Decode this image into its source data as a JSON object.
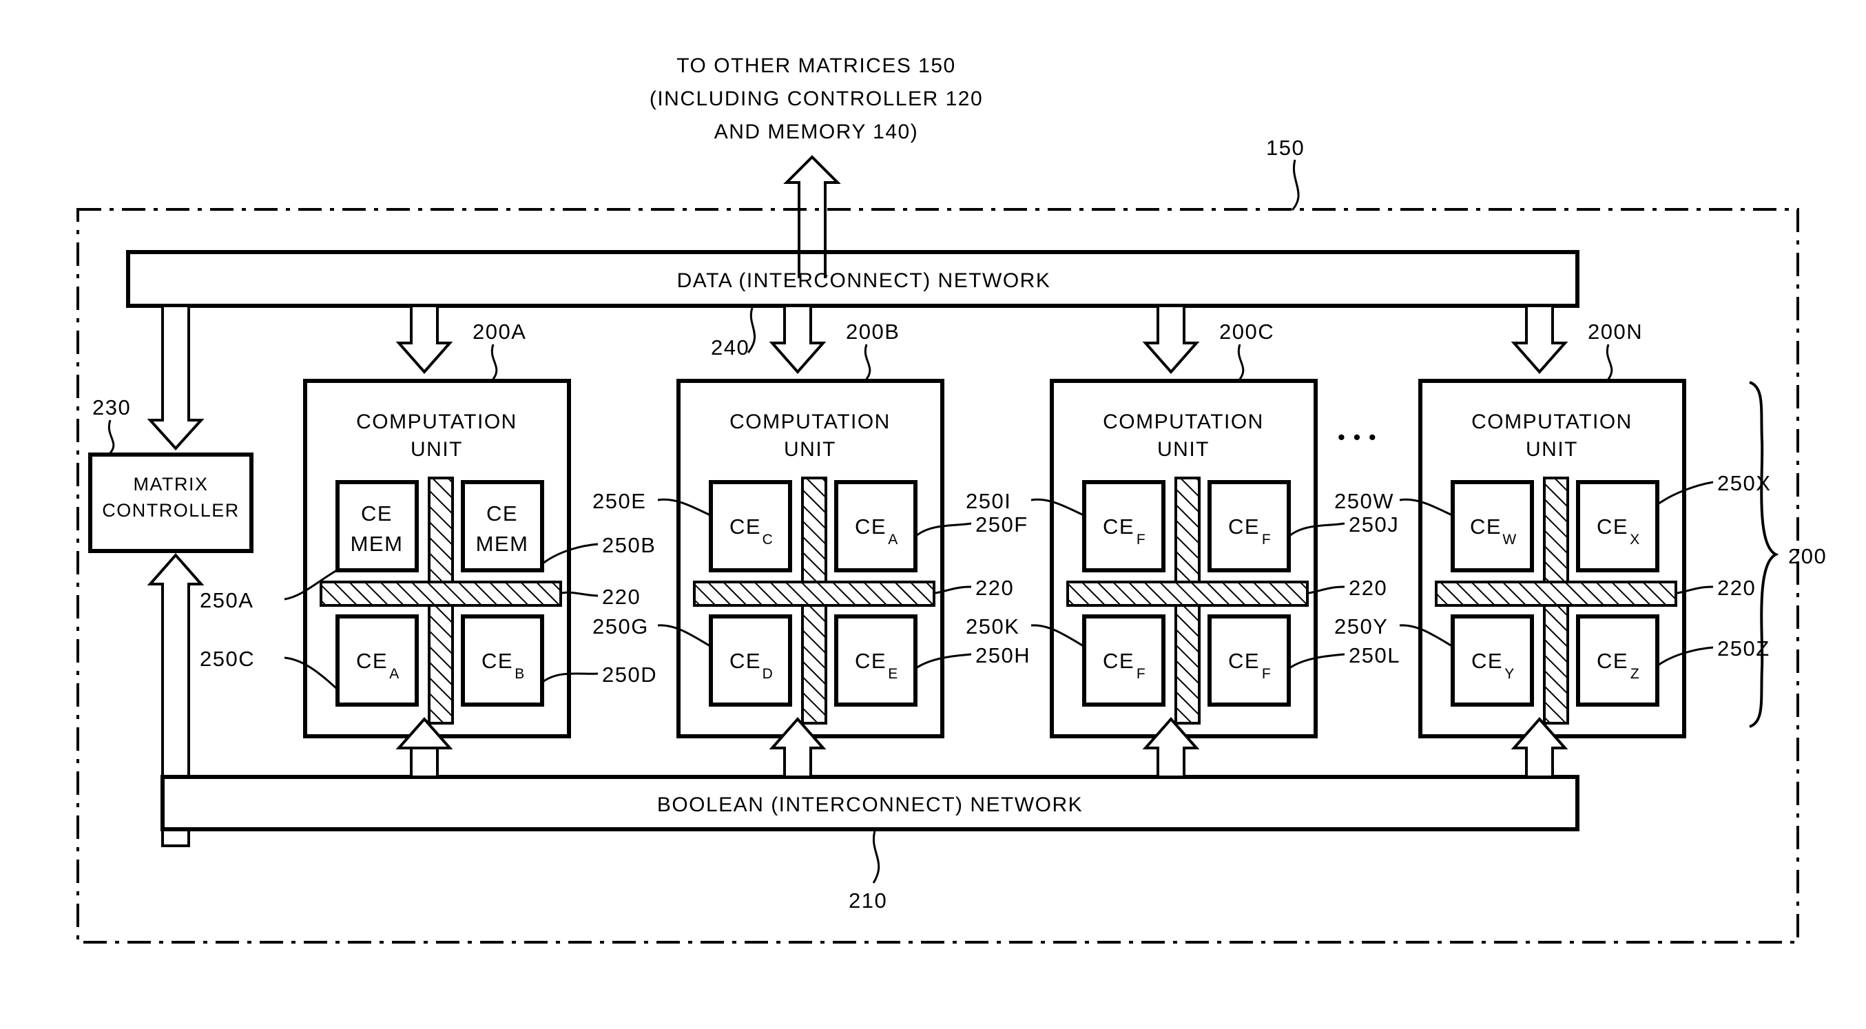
{
  "figure": {
    "header_lines": [
      "TO OTHER MATRICES 150",
      "(INCLUDING CONTROLLER 120",
      "AND MEMORY 140)"
    ],
    "outer_ref": "150",
    "brace_ref": "200",
    "data_network_label": "DATA (INTERCONNECT) NETWORK",
    "data_network_ref": "240",
    "boolean_network_label": "BOOLEAN (INTERCONNECT) NETWORK",
    "boolean_network_ref": "210",
    "ellipsis": "•  •  •"
  },
  "matrix_controller": {
    "line1": "MATRIX",
    "line2": "CONTROLLER",
    "ref": "230"
  },
  "units": [
    {
      "ref": "200A",
      "title_line1": "COMPUTATION",
      "title_line2": "UNIT",
      "cells": [
        {
          "base": "CE",
          "sub": "",
          "line2": "MEM",
          "ref": "250A",
          "ref_side": "left"
        },
        {
          "base": "CE",
          "sub": "",
          "line2": "MEM",
          "ref": "250B",
          "ref_side": "right"
        },
        {
          "base": "CE",
          "sub": "A",
          "line2": "",
          "ref": "250C",
          "ref_side": "left"
        },
        {
          "base": "CE",
          "sub": "B",
          "line2": "",
          "ref": "250D",
          "ref_side": "right"
        }
      ],
      "bus_ref": "220"
    },
    {
      "ref": "200B",
      "title_line1": "COMPUTATION",
      "title_line2": "UNIT",
      "cells": [
        {
          "base": "CE",
          "sub": "C",
          "line2": "",
          "ref": "250E",
          "ref_side": "left"
        },
        {
          "base": "CE",
          "sub": "A",
          "line2": "",
          "ref": "250F",
          "ref_side": "right"
        },
        {
          "base": "CE",
          "sub": "D",
          "line2": "",
          "ref": "250G",
          "ref_side": "left"
        },
        {
          "base": "CE",
          "sub": "E",
          "line2": "",
          "ref": "250H",
          "ref_side": "right"
        }
      ],
      "bus_ref": "220"
    },
    {
      "ref": "200C",
      "title_line1": "COMPUTATION",
      "title_line2": "UNIT",
      "cells": [
        {
          "base": "CE",
          "sub": "F",
          "line2": "",
          "ref": "250I",
          "ref_side": "left"
        },
        {
          "base": "CE",
          "sub": "F",
          "line2": "",
          "ref": "250J",
          "ref_side": "right"
        },
        {
          "base": "CE",
          "sub": "F",
          "line2": "",
          "ref": "250K",
          "ref_side": "left"
        },
        {
          "base": "CE",
          "sub": "F",
          "line2": "",
          "ref": "250L",
          "ref_side": "right"
        }
      ],
      "bus_ref": "220"
    },
    {
      "ref": "200N",
      "title_line1": "COMPUTATION",
      "title_line2": "UNIT",
      "cells": [
        {
          "base": "CE",
          "sub": "W",
          "line2": "",
          "ref": "250W",
          "ref_side": "left"
        },
        {
          "base": "CE",
          "sub": "X",
          "line2": "",
          "ref": "250X",
          "ref_side": "right"
        },
        {
          "base": "CE",
          "sub": "Y",
          "line2": "",
          "ref": "250Y",
          "ref_side": "left"
        },
        {
          "base": "CE",
          "sub": "Z",
          "line2": "",
          "ref": "250Z",
          "ref_side": "right"
        }
      ],
      "bus_ref": "220"
    }
  ],
  "colors": {
    "ink": "#000000",
    "paper": "#ffffff"
  }
}
